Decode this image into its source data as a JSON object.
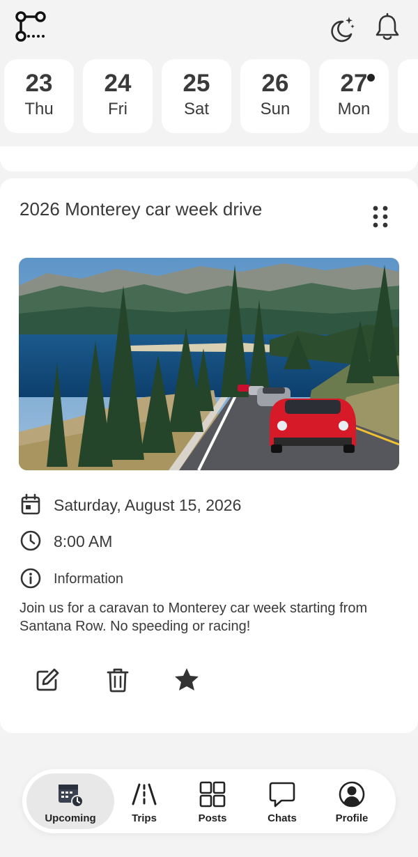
{
  "header": {
    "logo_icon": "route-icon",
    "theme_icon": "moon-stars-icon",
    "notifications_icon": "bell-icon"
  },
  "dates": [
    {
      "day": "23",
      "weekday": "Thu",
      "has_event": false
    },
    {
      "day": "24",
      "weekday": "Fri",
      "has_event": false
    },
    {
      "day": "25",
      "weekday": "Sat",
      "has_event": false
    },
    {
      "day": "26",
      "weekday": "Sun",
      "has_event": false
    },
    {
      "day": "27",
      "weekday": "Mon",
      "has_event": true
    }
  ],
  "event": {
    "title": "2026 Monterey car week drive",
    "date": "Saturday, August 15, 2026",
    "time": "8:00 AM",
    "info_label": "Information",
    "description": "Join us for a caravan to Monterey car week starting from Santana Row. No speeding or racing!",
    "actions": [
      "edit-icon",
      "trash-icon",
      "star-icon"
    ]
  },
  "nav": {
    "items": [
      {
        "label": "Upcoming",
        "icon": "calendar-clock-icon",
        "active": true
      },
      {
        "label": "Trips",
        "icon": "road-icon",
        "active": false
      },
      {
        "label": "Posts",
        "icon": "grid-icon",
        "active": false
      },
      {
        "label": "Chats",
        "icon": "chat-bubble-icon",
        "active": false
      },
      {
        "label": "Profile",
        "icon": "user-circle-icon",
        "active": false
      }
    ]
  },
  "colors": {
    "background": "#f3f3f3",
    "card": "#ffffff",
    "text": "#3a3a3a",
    "active_nav": "#e8e8e8"
  }
}
